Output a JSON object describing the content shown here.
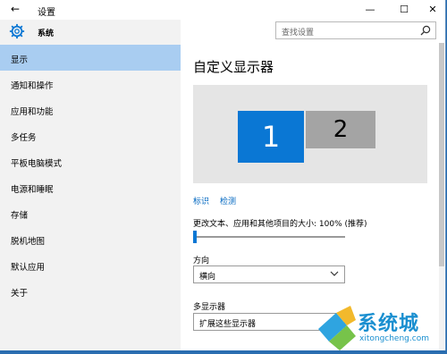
{
  "window": {
    "title": "设置",
    "back_icon": "back-arrow-icon",
    "minimize_icon": "minimize-icon",
    "maximize_icon": "maximize-icon",
    "close_icon": "close-icon"
  },
  "sidebar": {
    "app_label": "系统",
    "app_icon": "gear-icon",
    "items": [
      {
        "label": "显示",
        "active": true
      },
      {
        "label": "通知和操作"
      },
      {
        "label": "应用和功能"
      },
      {
        "label": "多任务"
      },
      {
        "label": "平板电脑模式"
      },
      {
        "label": "电源和睡眠"
      },
      {
        "label": "存储"
      },
      {
        "label": "脱机地图"
      },
      {
        "label": "默认应用"
      },
      {
        "label": "关于"
      }
    ]
  },
  "search": {
    "placeholder": "查找设置",
    "icon": "search-icon"
  },
  "main": {
    "title": "自定义显示器",
    "monitors": [
      {
        "label": "1",
        "selected": true,
        "color": "#0a77d4"
      },
      {
        "label": "2",
        "color": "#a4a4a4"
      }
    ],
    "links": {
      "identify": "标识",
      "detect": "检测"
    },
    "size_label": "更改文本、应用和其他项目的大小: 100% (推荐)",
    "size_slider_value": 0,
    "orientation_label": "方向",
    "orientation_value": "横向",
    "multi_display_label": "多显示器",
    "multi_display_value": "扩展这些显示器"
  },
  "watermark": {
    "text": "系统城",
    "url": "xitongcheng.com"
  },
  "colors": {
    "accent": "#0a77d4",
    "nav_active": "#a9cdf1",
    "link": "#0067c0"
  }
}
